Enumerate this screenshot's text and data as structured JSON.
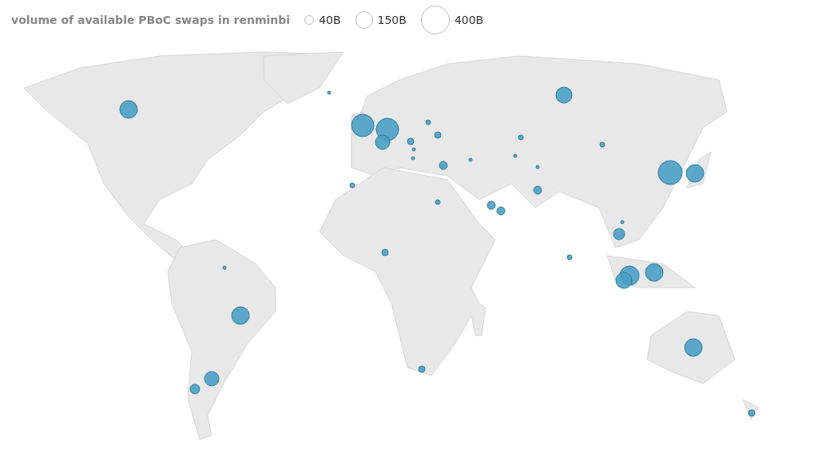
{
  "legend": {
    "title": "volume of available PBoC swaps in renminbi",
    "items": [
      {
        "label": "40B"
      },
      {
        "label": "150B"
      },
      {
        "label": "400B"
      }
    ]
  }
}
